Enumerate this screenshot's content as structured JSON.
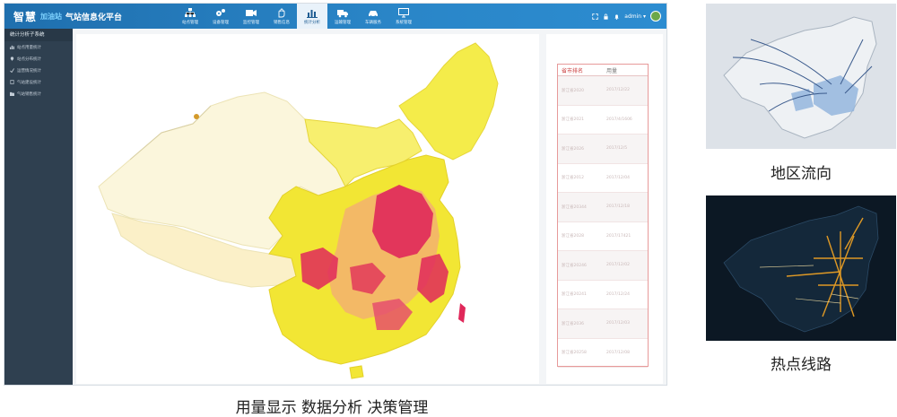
{
  "app": {
    "logo": "智慧",
    "logo_sub": "加油站",
    "title": "气站信息化平台",
    "user": "admin ▾"
  },
  "nav": [
    {
      "label": "站点管理",
      "icon": "sitemap-icon"
    },
    {
      "label": "设备管理",
      "icon": "gears-icon"
    },
    {
      "label": "监控管理",
      "icon": "camera-icon"
    },
    {
      "label": "销售信息",
      "icon": "hand-icon"
    },
    {
      "label": "统计分析",
      "icon": "bar-chart-icon",
      "active": true
    },
    {
      "label": "运输管理",
      "icon": "truck-icon"
    },
    {
      "label": "车辆服务",
      "icon": "car-icon"
    },
    {
      "label": "系统管理",
      "icon": "monitor-icon"
    }
  ],
  "sidebar": {
    "header": "统计分析子系统",
    "items": [
      {
        "label": "站点用量统计",
        "icon": "chart-icon"
      },
      {
        "label": "站点分布统计",
        "icon": "pin-icon"
      },
      {
        "label": "运营情况统计",
        "icon": "check-icon"
      },
      {
        "label": "气站建设统计",
        "icon": "doc-icon"
      },
      {
        "label": "气站销售统计",
        "icon": "folder-icon"
      }
    ]
  },
  "table": {
    "headers": [
      "省市排名",
      "用量"
    ],
    "rows": [
      [
        "浙江省2020",
        "2017/12/22"
      ],
      [
        "浙江省2021",
        "2017/4/1606"
      ],
      [
        "浙江省2026",
        "2017/12/5"
      ],
      [
        "浙江省2012",
        "2017/12/04"
      ],
      [
        "浙江省20344",
        "2017/12/18"
      ],
      [
        "浙江省2028",
        "2017/17421"
      ],
      [
        "浙江省20246",
        "2017/12/02"
      ],
      [
        "浙江省20241",
        "2017/12/24"
      ],
      [
        "浙江省2036",
        "2017/12/03"
      ],
      [
        "浙江省20258",
        "2017/12/08"
      ]
    ]
  },
  "captions": {
    "right_top": "地区流向",
    "right_bottom": "热点线路",
    "bottom": "用量显示  数据分析  决策管理"
  },
  "colors": {
    "topbar": "#2a86c8",
    "sidebar": "#2f4050",
    "map_low": "#f2ec3a",
    "map_mid": "#f0a070",
    "map_high": "#e0285a"
  }
}
